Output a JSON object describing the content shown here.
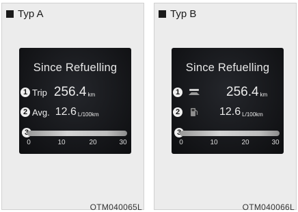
{
  "panels": [
    {
      "label": "Typ A",
      "screen_title": "Since Refuelling",
      "rows": [
        {
          "marker": "1",
          "label": "Trip",
          "value": "256.4",
          "unit": "km"
        },
        {
          "marker": "2",
          "label": "Avg.",
          "value": "12.6",
          "unit": "L/100km"
        }
      ],
      "bar_marker": "3",
      "scale": [
        "0",
        "10",
        "20",
        "30"
      ],
      "code": "OTM040065L"
    },
    {
      "label": "Typ B",
      "screen_title": "Since Refuelling",
      "rows": [
        {
          "marker": "1",
          "icon": "distance-icon",
          "value": "256.4",
          "unit": "km"
        },
        {
          "marker": "2",
          "icon": "fuel-pump-icon",
          "value": "12.6",
          "unit": "L/100km"
        }
      ],
      "bar_marker": "3",
      "scale": [
        "0",
        "10",
        "20",
        "30"
      ],
      "code": "OTM040066L"
    }
  ],
  "colors": {
    "screen": "#141518",
    "text": "#e8e8e8",
    "panel_bg": "#ececec"
  }
}
